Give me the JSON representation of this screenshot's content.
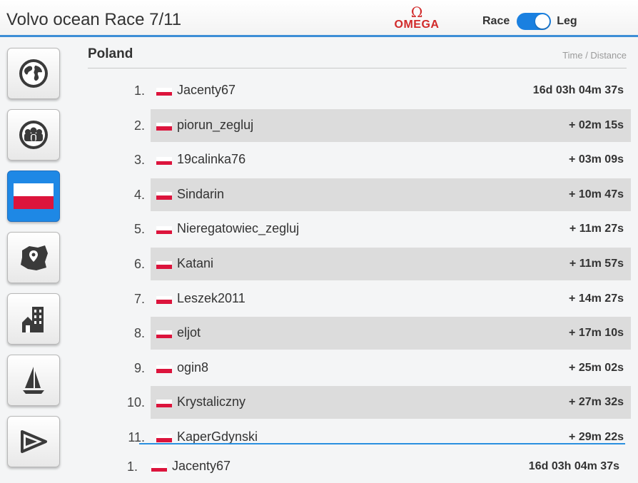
{
  "header": {
    "title": "Volvo ocean Race 7/11",
    "brand_symbol": "Ω",
    "brand_name": "OMEGA",
    "toggle": {
      "left_label": "Race",
      "right_label": "Leg",
      "selected": "Leg"
    }
  },
  "sidebar": {
    "items": [
      {
        "icon": "globe-icon",
        "active": false
      },
      {
        "icon": "group-icon",
        "active": false
      },
      {
        "icon": "poland-flag-icon",
        "active": true
      },
      {
        "icon": "region-map-icon",
        "active": false
      },
      {
        "icon": "city-icon",
        "active": false
      },
      {
        "icon": "sailboat-icon",
        "active": false
      },
      {
        "icon": "pennant-flag-icon",
        "active": false
      }
    ]
  },
  "section": {
    "title": "Poland",
    "subtitle": "Time / Distance"
  },
  "leaderboard": [
    {
      "rank": "1.",
      "name": "Jacenty67",
      "time": "16d 03h 04m 37s"
    },
    {
      "rank": "2.",
      "name": "piorun_zegluj",
      "time": "+ 02m 15s"
    },
    {
      "rank": "3.",
      "name": "19calinka76",
      "time": "+ 03m 09s"
    },
    {
      "rank": "4.",
      "name": "Sindarin",
      "time": "+ 10m 47s"
    },
    {
      "rank": "5.",
      "name": "Nieregatowiec_zegluj",
      "time": "+ 11m 27s"
    },
    {
      "rank": "6.",
      "name": "Katani",
      "time": "+ 11m 57s"
    },
    {
      "rank": "7.",
      "name": "Leszek2011",
      "time": "+ 14m 27s"
    },
    {
      "rank": "8.",
      "name": "eljot",
      "time": "+ 17m 10s"
    },
    {
      "rank": "9.",
      "name": "ogin8",
      "time": "+ 25m 02s"
    },
    {
      "rank": "10.",
      "name": "Krystaliczny",
      "time": "+ 27m 32s"
    },
    {
      "rank": "11.",
      "name": "KaperGdynski",
      "time": "+ 29m 22s"
    }
  ],
  "current_user": {
    "rank": "1.",
    "name": "Jacenty67",
    "time": "16d 03h 04m 37s"
  },
  "colors": {
    "accent": "#1e88e5",
    "flag_red": "#dc143c",
    "brand_red": "#d12a2a"
  }
}
